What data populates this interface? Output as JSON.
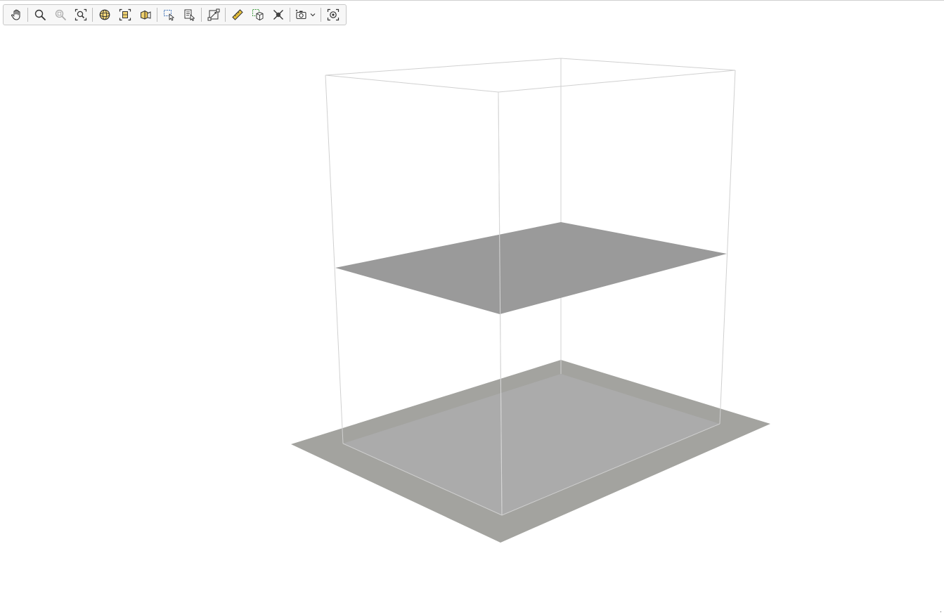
{
  "toolbar": {
    "groups": [
      [
        {
          "name": "pan-tool-button",
          "icon": "hand-icon"
        }
      ],
      [
        {
          "name": "zoom-button",
          "icon": "magnifier-icon"
        },
        {
          "name": "zoom-window-button",
          "icon": "magnifier-disabled-icon"
        },
        {
          "name": "zoom-extents-button",
          "icon": "zoom-extents-icon"
        }
      ],
      [
        {
          "name": "orbit-button",
          "icon": "orbit-icon"
        },
        {
          "name": "fit-view-button",
          "icon": "fit-frame-icon"
        },
        {
          "name": "view-cube-button",
          "icon": "box-view-icon"
        }
      ],
      [
        {
          "name": "select-button",
          "icon": "select-cursor-icon"
        },
        {
          "name": "select-list-button",
          "icon": "select-list-icon"
        }
      ],
      [
        {
          "name": "section-box-button",
          "icon": "section-box-icon"
        }
      ],
      [
        {
          "name": "measure-button",
          "icon": "ruler-icon"
        },
        {
          "name": "isolate-button",
          "icon": "isolate-icon"
        },
        {
          "name": "clear-button",
          "icon": "clear-x-icon"
        }
      ],
      [
        {
          "name": "snapshot-dropdown",
          "icon": "camera-icon"
        }
      ],
      [
        {
          "name": "focus-button",
          "icon": "focus-target-icon"
        }
      ]
    ]
  },
  "colors": {
    "slab": "#9b9b9b",
    "floor": "#a9a9a9",
    "ground": "#a2a29e",
    "wireframe": "#d2d2d2",
    "accent_yellow": "#e8c13a",
    "accent_green": "#3d9a3d"
  }
}
